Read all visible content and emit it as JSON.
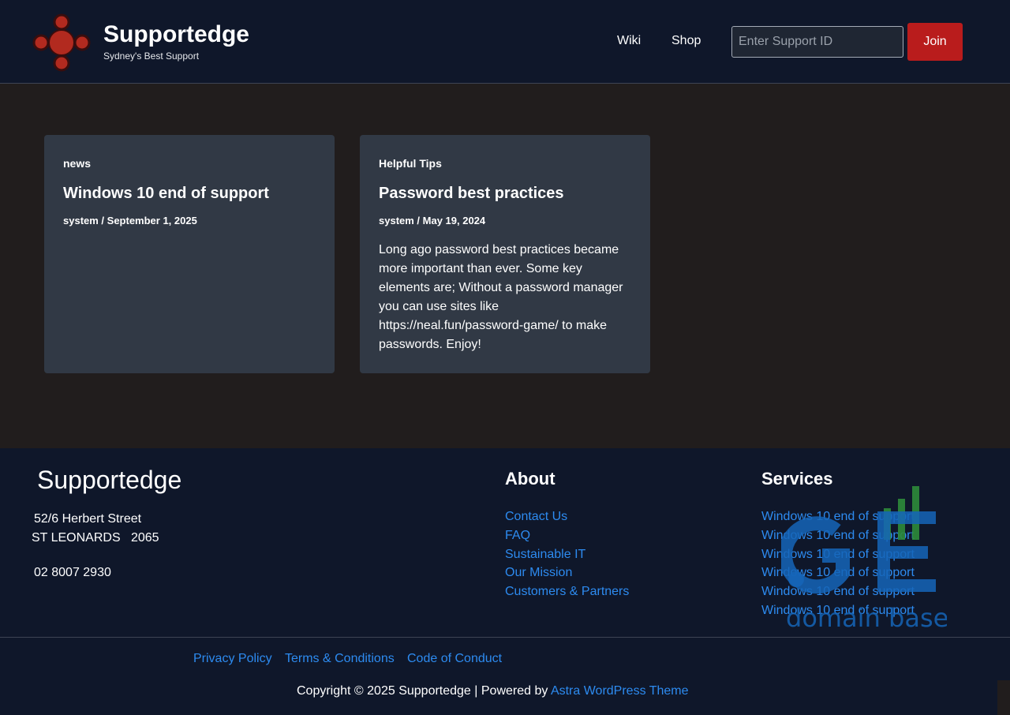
{
  "header": {
    "brand_title": "Supportedge",
    "brand_tagline": "Sydney's Best Support",
    "nav": [
      "Wiki",
      "Shop"
    ],
    "support_placeholder": "Enter Support ID",
    "join_label": "Join",
    "logo_icon": "red-nodes-logo-icon"
  },
  "posts": [
    {
      "category": "news",
      "title": "Windows 10 end of support",
      "meta": "system / September 1, 2025",
      "excerpt": ""
    },
    {
      "category": "Helpful Tips",
      "title": "Password best practices",
      "meta": "system / May 19, 2024",
      "excerpt": "Long ago password best practices became more important than ever. Some key elements are; Without a password manager you can use sites like https://neal.fun/password-game/ to make passwords. Enjoy!"
    }
  ],
  "footer": {
    "brand": "Supportedge",
    "address_line1": "52/6 Herbert Street",
    "address_line2": "ST LEONARDS   2065",
    "phone": "02 8007 2930",
    "about": {
      "heading": "About",
      "links": [
        "Contact Us",
        "FAQ",
        "Sustainable IT",
        "Our Mission",
        "Customers & Partners"
      ]
    },
    "services": {
      "heading": "Services",
      "links": [
        "Windows 10 end of support",
        "Windows 10 end of support",
        "Windows 10 end of support",
        "Windows 10 end of support",
        "Windows 10 end of support",
        "Windows 10 end of support"
      ]
    },
    "legal_links": [
      "Privacy Policy",
      "Terms & Conditions",
      "Code of Conduct"
    ],
    "copyright_prefix": "Copyright © 2025 Supportedge | Powered by ",
    "copyright_link": "Astra WordPress Theme",
    "watermark_text": "domain base",
    "watermark_letters": "GE"
  },
  "colors": {
    "header_bg": "#0f172a",
    "body_bg": "#211d1d",
    "card_bg": "#313945",
    "accent_red": "#b91c1c",
    "link_blue": "#2d8bf0"
  }
}
